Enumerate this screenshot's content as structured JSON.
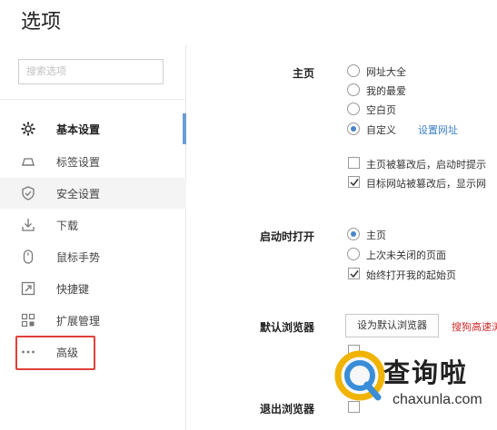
{
  "header": {
    "title": "选项"
  },
  "search": {
    "placeholder": "搜索选项"
  },
  "sidebar": {
    "items": [
      {
        "label": "基本设置",
        "icon": "gear-icon",
        "active": true
      },
      {
        "label": "标签设置",
        "icon": "tab-icon"
      },
      {
        "label": "安全设置",
        "icon": "shield-icon"
      },
      {
        "label": "下载",
        "icon": "download-icon"
      },
      {
        "label": "鼠标手势",
        "icon": "mouse-icon"
      },
      {
        "label": "快捷键",
        "icon": "shortcut-icon"
      },
      {
        "label": "扩展管理",
        "icon": "extensions-icon"
      },
      {
        "label": "高级",
        "icon": "more-dots-icon"
      }
    ]
  },
  "home": {
    "label": "主页",
    "options": [
      "网址大全",
      "我的最爱",
      "空白页",
      "自定义"
    ],
    "selected": "自定义",
    "set_url_link": "设置网址",
    "checks": [
      {
        "text": "主页被篡改后，启动时提示",
        "checked": false
      },
      {
        "text": "目标网站被篡改后，显示网",
        "checked": true
      }
    ]
  },
  "startup": {
    "label": "启动时打开",
    "options": [
      "主页",
      "上次未关闭的页面"
    ],
    "selected": "主页",
    "checks": [
      {
        "text": "始终打开我的起始页",
        "checked": true
      }
    ]
  },
  "default_browser": {
    "label": "默认浏览器",
    "button": "设为默认浏览器",
    "warning": "搜狗高速浏"
  },
  "exit_browser": {
    "label": "退出浏览器"
  },
  "watermark": {
    "text": "查询啦",
    "url": "chaxunla.com"
  },
  "colors": {
    "accent": "#4a86c6",
    "active_bar": "#6a9ed6",
    "highlight": "#e0403a",
    "warning": "#d02a2a"
  }
}
